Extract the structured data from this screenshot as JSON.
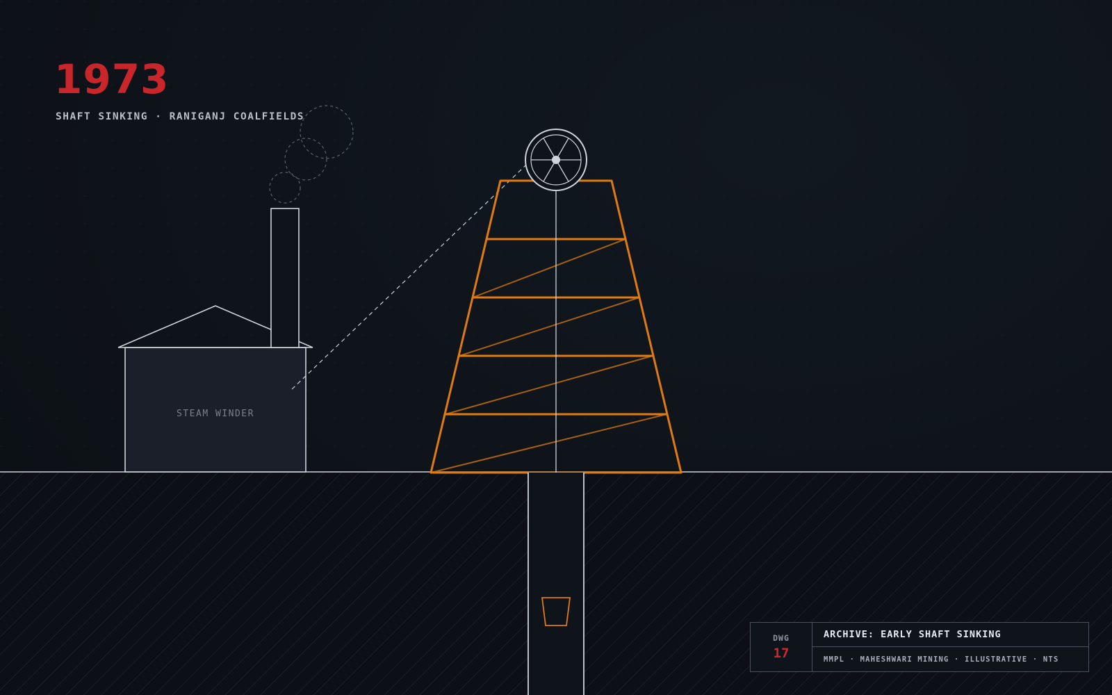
{
  "header": {
    "year": "1973",
    "subtitle": "SHAFT SINKING · RANIGANJ COALFIELDS"
  },
  "winder": {
    "label": "STEAM WINDER"
  },
  "title_block": {
    "dwg_label": "DWG",
    "dwg_number": "17",
    "title": "ARCHIVE: EARLY SHAFT SINKING",
    "meta": "MMPL · MAHESHWARI MINING · ILLUSTRATIVE · NTS"
  },
  "colors": {
    "accent_red": "#c8262b",
    "headframe_orange": "#e07b12",
    "line_white": "#d8dce4",
    "background": "#0f141b"
  },
  "icons": {
    "sheave_wheel": "sheave-wheel-icon",
    "kibble_bucket": "kibble-bucket-icon",
    "smoke_puffs": "smoke-icon"
  }
}
